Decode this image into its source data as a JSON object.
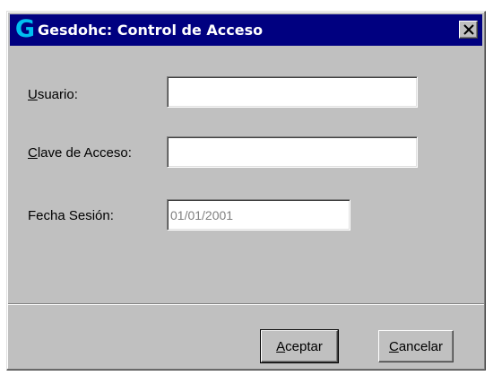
{
  "window": {
    "logo": "G",
    "title": "Gesdohc: Control de Acceso",
    "close_icon": "close-icon"
  },
  "form": {
    "usuario": {
      "label_accel": "U",
      "label_rest": "suario:",
      "value": ""
    },
    "clave": {
      "label_accel": "C",
      "label_rest": "lave de Acceso:",
      "value": ""
    },
    "fecha": {
      "label": "Fecha Sesión:",
      "value": "01/01/2001"
    }
  },
  "buttons": {
    "accept": {
      "accel": "A",
      "rest": "ceptar"
    },
    "cancel": {
      "accel": "C",
      "rest": "ancelar"
    }
  },
  "colors": {
    "titlebar": "#000080",
    "face": "#c0c0c0",
    "logo": "#00c0f0"
  }
}
